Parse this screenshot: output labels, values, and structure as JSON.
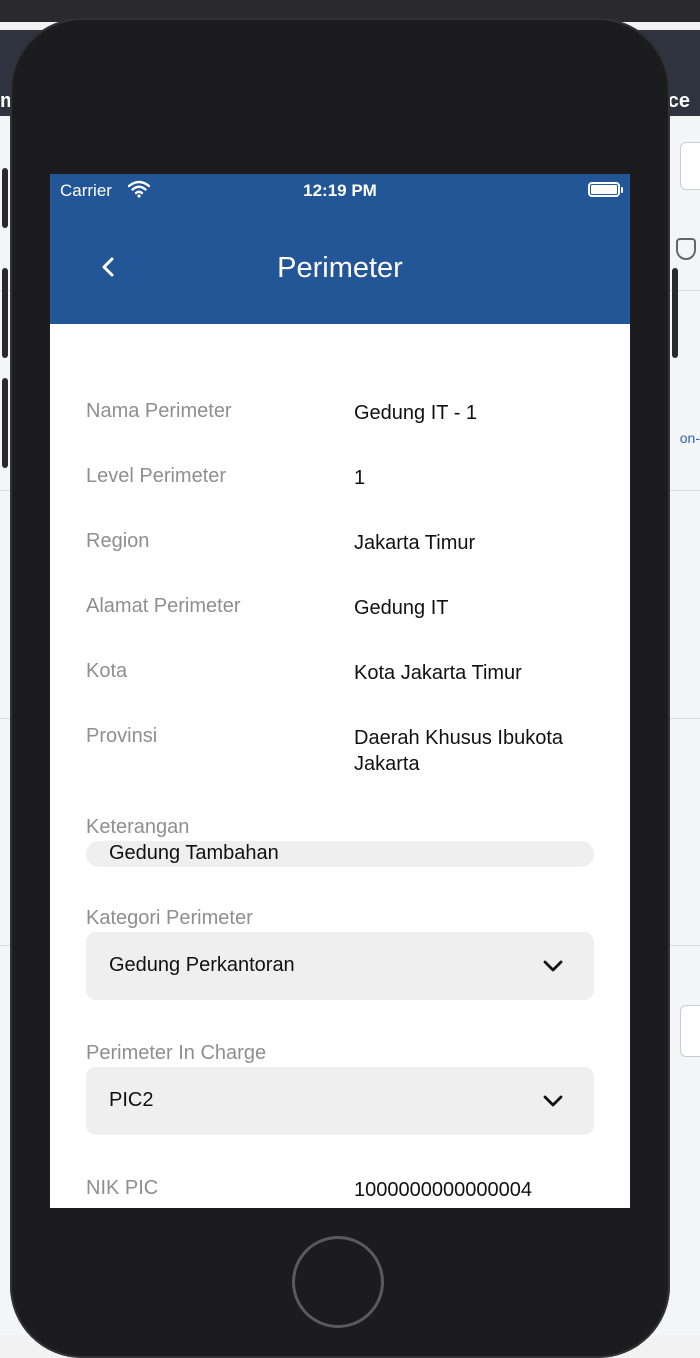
{
  "background_app": {
    "left_fragment": "m",
    "right_fragment": "ce",
    "link_fragment": "on-"
  },
  "status_bar": {
    "carrier": "Carrier",
    "time": "12:19 PM"
  },
  "nav": {
    "title": "Perimeter"
  },
  "details": [
    {
      "label": "Nama Perimeter",
      "value": "Gedung IT - 1"
    },
    {
      "label": "Level Perimeter",
      "value": "1"
    },
    {
      "label": "Region",
      "value": "Jakarta Timur"
    },
    {
      "label": "Alamat Perimeter",
      "value": "Gedung IT"
    },
    {
      "label": "Kota",
      "value": "Kota Jakarta Timur"
    },
    {
      "label": "Provinsi",
      "value": "Daerah Khusus Ibukota Jakarta"
    }
  ],
  "keterangan": {
    "label": "Keterangan",
    "value": "Gedung Tambahan"
  },
  "kategori": {
    "label": "Kategori Perimeter",
    "value": "Gedung Perkantoran"
  },
  "pic": {
    "label": "Perimeter In Charge",
    "value": "PIC2"
  },
  "nik": {
    "label": "NIK PIC",
    "value": "1000000000000004"
  },
  "colors": {
    "nav_blue": "#235697",
    "label_gray": "#8e8e93",
    "field_bg": "#efefef"
  }
}
